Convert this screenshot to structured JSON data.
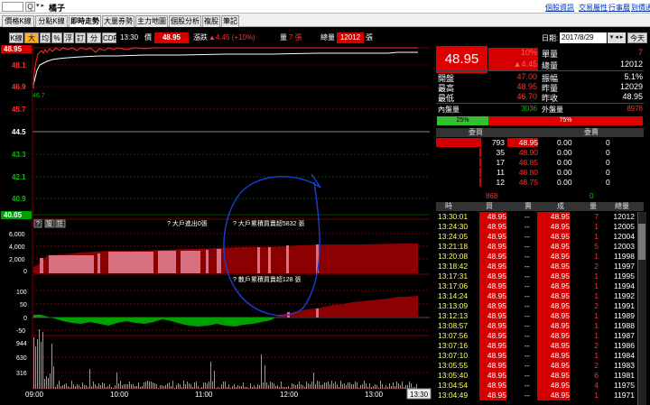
{
  "topbar": {
    "stock_code_value": "",
    "search_glyph": "Q",
    "dropdown_glyph": "▾ ▸",
    "stock_name": "橘子",
    "links": [
      "個股資訊",
      "交易屬性",
      "行事曆",
      "到價通知"
    ]
  },
  "tabs": [
    "價格K線",
    "分點K線",
    "即時走勢",
    "大量券勢",
    "主力地圖",
    "個股分析",
    "複股",
    "筆記"
  ],
  "active_tab": "即時走勢",
  "toolbar": {
    "buttons": [
      "K線",
      "大戶",
      "均",
      "%",
      "浮",
      "訂",
      "分價",
      "CDP"
    ],
    "time": "13:30",
    "price_label": "價",
    "price": "48.95",
    "change_label": "漲跌",
    "change": "▲4.45 (+10%)",
    "vol_label": "量",
    "vol": "7 張",
    "total_label": "總量",
    "total": "12012",
    "total_unit": "張"
  },
  "price_axis": [
    "48.95",
    "48.1",
    "46.9",
    "45.7",
    "44.5",
    "43.3",
    "42.1",
    "40.9",
    "40.05"
  ],
  "price_low_label": "46.7",
  "sub_panel_1": {
    "toolbar": [
      "?",
      "設",
      "註"
    ],
    "annotation_1": "? 大戶進出0張",
    "annotation_2": "? 大戶累積買賣超5832 張",
    "yaxis": [
      "6,000",
      "4,000",
      "2,000",
      "0"
    ]
  },
  "sub_panel_2": {
    "annotation": "? 散戶累積買賣超128 張",
    "yaxis": [
      "100",
      "50",
      "0",
      "-50"
    ]
  },
  "vol_panel": {
    "yaxis": [
      "944",
      "630",
      "316"
    ]
  },
  "time_axis": [
    "09:00",
    "10:00",
    "11:00",
    "12:00",
    "13:00"
  ],
  "time_badge": "13:30",
  "right_panel": {
    "date_label": "日期:",
    "date_value": "2017/8/29",
    "nav_glyph": "▾ ◂ ▸",
    "today_btn": "今天",
    "price": "48.95",
    "pct": "10%",
    "change": "▲4.45",
    "stats": [
      {
        "k1": "單量",
        "v1": "7",
        "c1": "#ff3030"
      },
      {
        "k1": "總量",
        "v1": "12012",
        "c1": "#ffffff"
      }
    ],
    "stats2": [
      {
        "k": "開盤",
        "v": "47.00",
        "c": "#ff3030",
        "k2": "振幅",
        "v2": "5.1%",
        "c2": "#ffffff"
      },
      {
        "k": "最高",
        "v": "48.95",
        "c": "#ff3030",
        "k2": "昨量",
        "v2": "12029",
        "c2": "#ffffff"
      },
      {
        "k": "最低",
        "v": "46.70",
        "c": "#ff3030",
        "k2": "昨收",
        "v2": "48.95",
        "c2": "#ffffff"
      }
    ],
    "inner_label": "內盤量",
    "inner_val": "3036",
    "outer_label": "外盤量",
    "outer_val": "8976",
    "bar_green_pct": "25%",
    "bar_red_pct": "75%",
    "bar_green_fraction": 0.25,
    "bid_header": "委買",
    "ask_header": "委賣",
    "book": [
      {
        "bidq": "793",
        "bidp": "48.95",
        "askp": "0.00",
        "askq": "0"
      },
      {
        "bidq": "35",
        "bidp": "48.90",
        "askp": "0.00",
        "askq": "0"
      },
      {
        "bidq": "17",
        "bidp": "48.85",
        "askp": "0.00",
        "askq": "0"
      },
      {
        "bidq": "11",
        "bidp": "48.80",
        "askp": "0.00",
        "askq": "0"
      },
      {
        "bidq": "12",
        "bidp": "48.75",
        "askp": "0.00",
        "askq": "0"
      }
    ],
    "sum_left": "868",
    "sum_right": "0",
    "tick_headers": [
      "時",
      "買",
      "賣",
      "成",
      "量",
      "總量"
    ],
    "ticks": [
      {
        "t": "13:30:01",
        "b": "48.95",
        "s": "--",
        "p": "48.95",
        "q": "7",
        "tot": "12012"
      },
      {
        "t": "13:24:30",
        "b": "48.95",
        "s": "--",
        "p": "48.95",
        "q": "1",
        "tot": "12005"
      },
      {
        "t": "13:24:05",
        "b": "48.95",
        "s": "--",
        "p": "48.95",
        "q": "1",
        "tot": "12004"
      },
      {
        "t": "13:21:18",
        "b": "48.95",
        "s": "--",
        "p": "48.95",
        "q": "5",
        "tot": "12003"
      },
      {
        "t": "13:20:08",
        "b": "48.95",
        "s": "--",
        "p": "48.95",
        "q": "1",
        "tot": "11998"
      },
      {
        "t": "13:18:42",
        "b": "48.95",
        "s": "--",
        "p": "48.95",
        "q": "2",
        "tot": "11997"
      },
      {
        "t": "13:17:31",
        "b": "48.95",
        "s": "--",
        "p": "48.95",
        "q": "1",
        "tot": "11995"
      },
      {
        "t": "13:17:06",
        "b": "48.95",
        "s": "--",
        "p": "48.95",
        "q": "1",
        "tot": "11994"
      },
      {
        "t": "13:14:24",
        "b": "48.95",
        "s": "--",
        "p": "48.95",
        "q": "1",
        "tot": "11992"
      },
      {
        "t": "13:13:09",
        "b": "48.95",
        "s": "--",
        "p": "48.95",
        "q": "2",
        "tot": "11991"
      },
      {
        "t": "13:12:13",
        "b": "48.95",
        "s": "--",
        "p": "48.95",
        "q": "1",
        "tot": "11989"
      },
      {
        "t": "13:08:57",
        "b": "48.95",
        "s": "--",
        "p": "48.95",
        "q": "1",
        "tot": "11988"
      },
      {
        "t": "13:07:56",
        "b": "48.95",
        "s": "--",
        "p": "48.95",
        "q": "1",
        "tot": "11987"
      },
      {
        "t": "13:07:16",
        "b": "48.95",
        "s": "--",
        "p": "48.95",
        "q": "2",
        "tot": "11986"
      },
      {
        "t": "13:07:10",
        "b": "48.95",
        "s": "--",
        "p": "48.95",
        "q": "1",
        "tot": "11984"
      },
      {
        "t": "13:05:55",
        "b": "48.95",
        "s": "--",
        "p": "48.95",
        "q": "2",
        "tot": "11983"
      },
      {
        "t": "13:05:40",
        "b": "48.95",
        "s": "--",
        "p": "48.95",
        "q": "6",
        "tot": "11981"
      },
      {
        "t": "13:04:54",
        "b": "48.95",
        "s": "--",
        "p": "48.95",
        "q": "4",
        "tot": "11975"
      },
      {
        "t": "13:04:49",
        "b": "48.95",
        "s": "--",
        "p": "48.95",
        "q": "1",
        "tot": "11971"
      }
    ]
  },
  "colors": {
    "up": "#ff3030",
    "down": "#00c000",
    "price_bg": "#e00000",
    "gridline": "#7a0000",
    "bar_dark": "#8b0000",
    "bar_light": "#d87080",
    "annot_blue": "#1a3fd0"
  }
}
